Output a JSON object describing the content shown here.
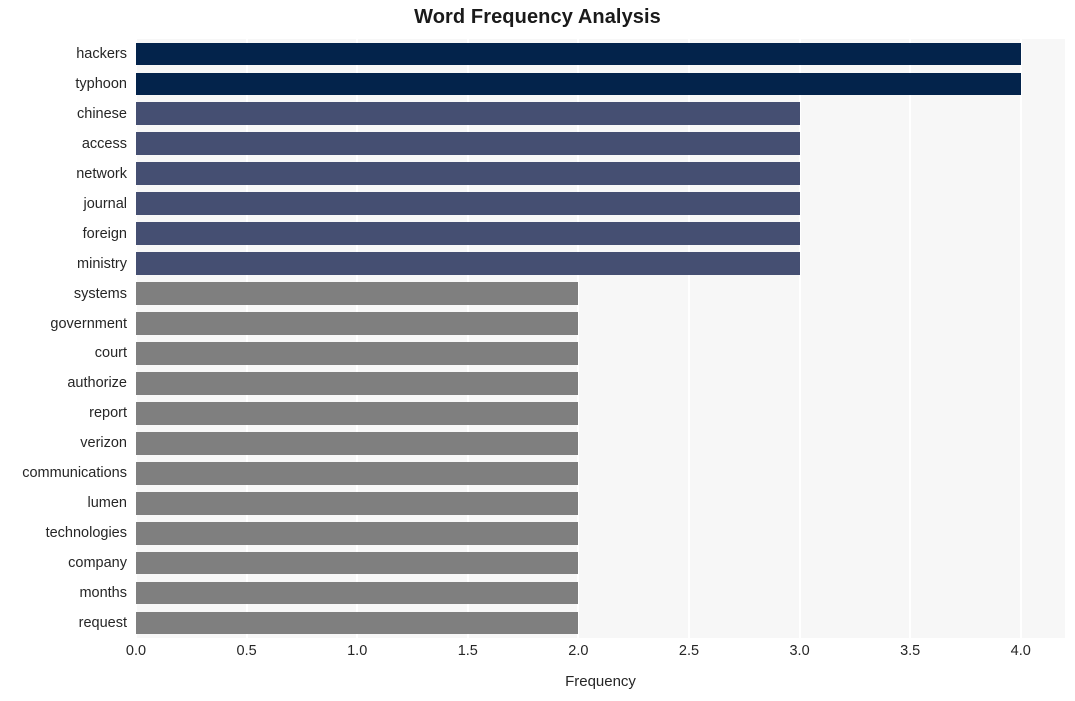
{
  "chart_data": {
    "type": "bar",
    "orientation": "horizontal",
    "title": "Word Frequency Analysis",
    "xlabel": "Frequency",
    "ylabel": "",
    "xlim": [
      0.0,
      4.2
    ],
    "xticks": [
      "0.0",
      "0.5",
      "1.0",
      "1.5",
      "2.0",
      "2.5",
      "3.0",
      "3.5",
      "4.0"
    ],
    "xtick_values": [
      0.0,
      0.5,
      1.0,
      1.5,
      2.0,
      2.5,
      3.0,
      3.5,
      4.0
    ],
    "grid": true,
    "grid_axis": "x",
    "legend": "none",
    "categories": [
      "hackers",
      "typhoon",
      "chinese",
      "access",
      "network",
      "journal",
      "foreign",
      "ministry",
      "systems",
      "government",
      "court",
      "authorize",
      "report",
      "verizon",
      "communications",
      "lumen",
      "technologies",
      "company",
      "months",
      "request"
    ],
    "values": [
      4,
      4,
      3,
      3,
      3,
      3,
      3,
      3,
      2,
      2,
      2,
      2,
      2,
      2,
      2,
      2,
      2,
      2,
      2,
      2
    ],
    "bar_colors": [
      "#03234b",
      "#03234b",
      "#454f72",
      "#454f72",
      "#454f72",
      "#454f72",
      "#454f72",
      "#454f72",
      "#7f7f7f",
      "#7f7f7f",
      "#7f7f7f",
      "#7f7f7f",
      "#7f7f7f",
      "#7f7f7f",
      "#7f7f7f",
      "#7f7f7f",
      "#7f7f7f",
      "#7f7f7f",
      "#7f7f7f",
      "#7f7f7f"
    ]
  },
  "style": {
    "figure_background": "#ffffff",
    "axes_background": "#f7f7f7",
    "gridline_color": "#ffffff",
    "text_color": "#262626",
    "color_high": "#03234b",
    "color_mid": "#454f72",
    "color_low": "#7f7f7f"
  }
}
